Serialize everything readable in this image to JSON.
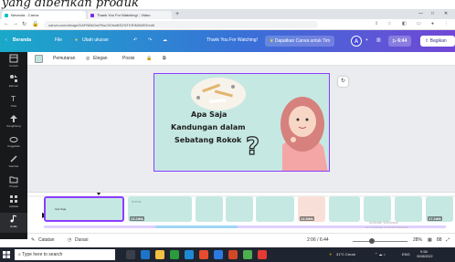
{
  "banner": {
    "text": "yang diberikan produk"
  },
  "browser": {
    "tabs": [
      {
        "label": "Beranda - Canva",
        "color": "#00c4cc"
      },
      {
        "label": "Thank You For Watching! - Video",
        "color": "#7d2ae8"
      }
    ],
    "url": "canva.com/design/DAFNBkOmPAs/2lOhwBSZNTKRIM0ME9/edit"
  },
  "canva_toolbar": {
    "home": "Beranda",
    "file": "File",
    "resize": "Ubah ukuran",
    "title": "Thank You For Watching!",
    "team_button": "Dapatkan Canva untuk Tim",
    "avatar": "A",
    "play_time": "6:44",
    "share": "Bagikan"
  },
  "sidebar": {
    "items": [
      {
        "label": "Contoh",
        "icon": "template-icon"
      },
      {
        "label": "Elemen",
        "icon": "elements-icon"
      },
      {
        "label": "Teks",
        "icon": "text-icon"
      },
      {
        "label": "Penghitung",
        "icon": "upload-icon"
      },
      {
        "label": "Unggahan",
        "icon": "cloud-icon"
      },
      {
        "label": "Gambar",
        "icon": "draw-icon"
      },
      {
        "label": "Proyek",
        "icon": "folder-icon"
      },
      {
        "label": "Aplikasi",
        "icon": "apps-icon"
      },
      {
        "label": "Audio",
        "icon": "audio-icon"
      }
    ]
  },
  "editbar": {
    "transition": "Pemutaran",
    "animate": "Elegan",
    "position": "Posisi"
  },
  "slide": {
    "line1": "Apa Saja",
    "line2": "Kandungan dalam",
    "line3": "Sebatang Rokok",
    "question": "?"
  },
  "timeline": {
    "durations": [
      "",
      "13.2dtk",
      "",
      "",
      "",
      "",
      "14.5dtk",
      "",
      "",
      "",
      "17.2dtk"
    ]
  },
  "status": {
    "notes": "Catatan",
    "duration": "Durasi",
    "time": "2:06 / 6:44",
    "zoom": "28%",
    "pages": "88"
  },
  "watermark": {
    "line1": "Activate Windows",
    "line2": "Go to Settings to activate Windows"
  },
  "taskbar": {
    "search": "Type here to search",
    "weather": "31°C Cerah",
    "time": "9:58",
    "date": "30/08/2022",
    "lang": "ENG"
  }
}
